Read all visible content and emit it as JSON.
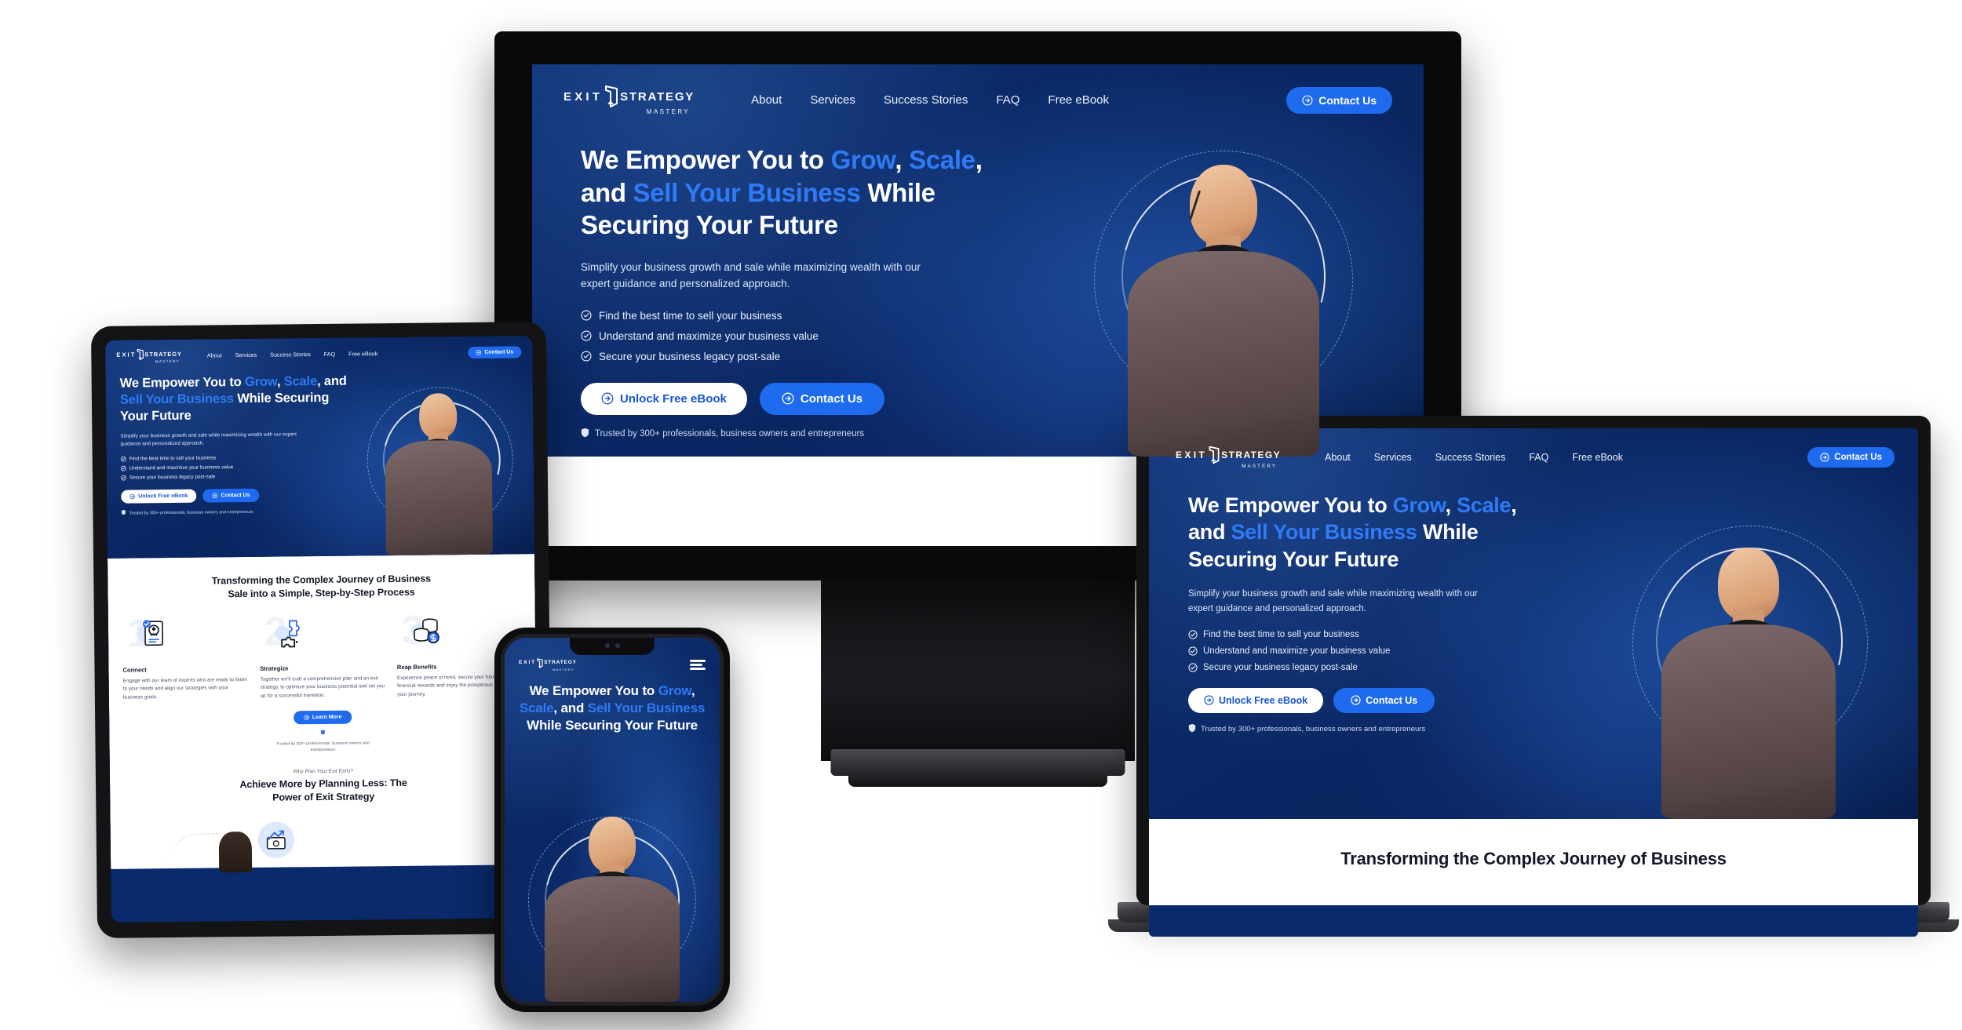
{
  "brand": {
    "name_exit": "EXIT",
    "name_strategy": "STRATEGY",
    "name_mastery": "MASTERY",
    "accent_blue": "#2f7bf6",
    "cta_blue": "#1e6bf0",
    "hero_bg": "#0a2560"
  },
  "nav": {
    "items": [
      "About",
      "Services",
      "Success Stories",
      "FAQ",
      "Free eBook"
    ],
    "cta_label": "Contact Us"
  },
  "hero": {
    "heading_parts": [
      {
        "text": "We Empower You to ",
        "accent": false
      },
      {
        "text": "Grow",
        "accent": true
      },
      {
        "text": ", ",
        "accent": false
      },
      {
        "text": "Scale",
        "accent": true
      },
      {
        "text": ", and ",
        "accent": false
      },
      {
        "text": "Sell Your Business",
        "accent": true
      },
      {
        "text": " While Securing Your Future",
        "accent": false
      }
    ],
    "heading_plain": "We Empower You to Grow, Scale, and Sell Your Business While Securing Your Future",
    "subtitle": "Simplify your business growth and sale while maximizing wealth with our expert guidance and personalized approach.",
    "bullets": [
      "Find the best time to sell your business",
      "Understand and maximize your business value",
      "Secure your business legacy post-sale"
    ],
    "cta_secondary": "Unlock Free eBook",
    "cta_primary": "Contact Us",
    "trust": "Trusted by 300+ professionals, business owners and entrepreneurs",
    "trust_wrapped": "Trusted by 300+ professionals, business owners and entrepreneurs"
  },
  "process": {
    "title": "Transforming the Complex Journey of Business Sale into a Simple, Step-by-Step Process",
    "title_line1": "Transforming the Complex Journey of Business",
    "title_line2": "Sale into a Simple, Step-by-Step Process",
    "steps": [
      {
        "number": "1",
        "title": "Connect",
        "body": "Engage with our team of experts who are ready to listen to your needs and align our strategies with your business goals.",
        "icon": "profile-document-icon"
      },
      {
        "number": "2",
        "title": "Strategize",
        "body": "Together we'll craft a comprehensive plan and an exit strategy, to optimize your business potential and set you up for a successful transition.",
        "icon": "puzzle-pieces-icon"
      },
      {
        "number": "3",
        "title": "Reap Benefits",
        "body": "Experience peace of mind, secure your future, reap the financial rewards and enjoy the prosperous outcome of your journey.",
        "icon": "coins-stack-icon"
      }
    ],
    "learn_more_label": "Learn More"
  },
  "why": {
    "eyebrow": "Why Plan Your Exit Early?",
    "title_line1": "Achieve More by Planning Less: The",
    "title_line2": "Power of Exit Strategy",
    "title": "Achieve More by Planning Less: The Power of Exit Strategy"
  },
  "laptop_section": {
    "heading_partial": "Transforming the Complex  Journey of Business"
  },
  "icons": {
    "check_circle": "check-circle-icon",
    "arrow_circle": "arrow-circle-right-icon",
    "shield": "shield-icon",
    "hamburger": "hamburger-menu-icon"
  }
}
